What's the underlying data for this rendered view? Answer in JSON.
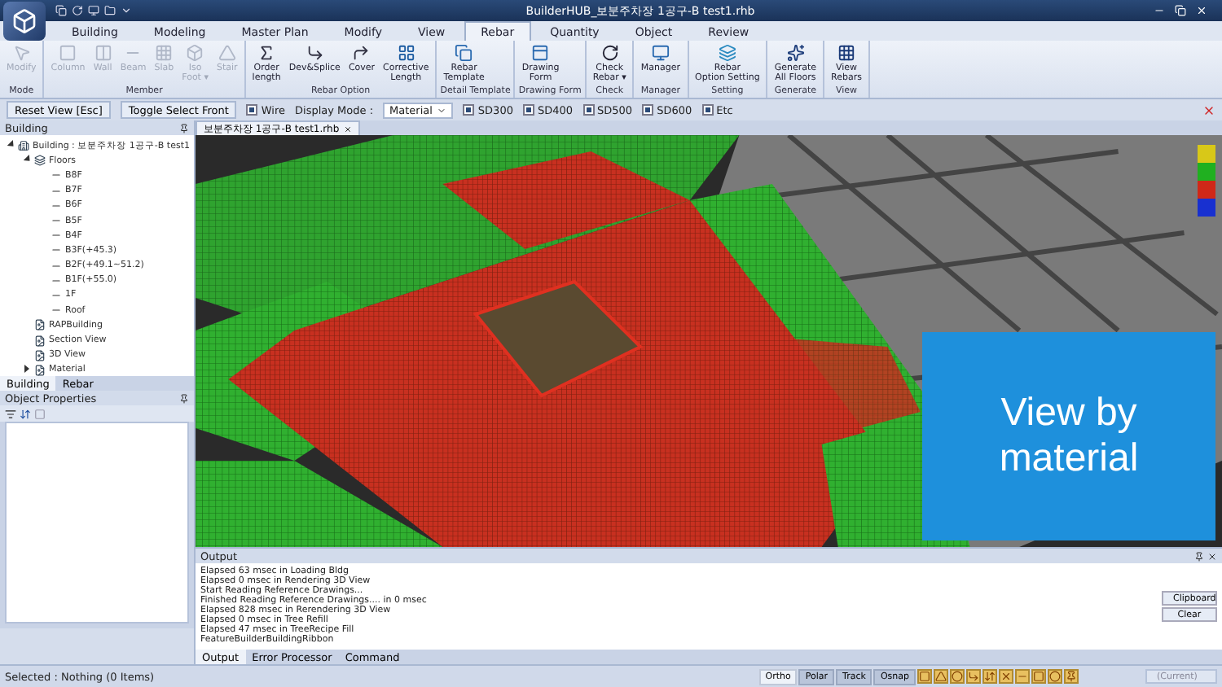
{
  "window": {
    "title": "BuilderHUB_보분주차장 1공구-B test1.rhb"
  },
  "tabs": [
    {
      "label": "Building",
      "selected": false
    },
    {
      "label": "Modeling",
      "selected": false
    },
    {
      "label": "Master Plan",
      "selected": false
    },
    {
      "label": "Modify",
      "selected": false
    },
    {
      "label": "View",
      "selected": false
    },
    {
      "label": "Rebar",
      "selected": true
    },
    {
      "label": "Quantity",
      "selected": false
    },
    {
      "label": "Object",
      "selected": false
    },
    {
      "label": "Review",
      "selected": false
    }
  ],
  "ribbon": [
    {
      "label": "Mode",
      "buttons": [
        {
          "label": "Modify",
          "disabled": true
        }
      ]
    },
    {
      "label": "Member",
      "buttons": [
        {
          "label": "Column",
          "disabled": true
        },
        {
          "label": "Wall",
          "disabled": true
        },
        {
          "label": "Beam",
          "disabled": true
        },
        {
          "label": "Slab",
          "disabled": true
        },
        {
          "label": "Iso\nFoot ▾",
          "disabled": true
        },
        {
          "label": "Stair",
          "disabled": true
        }
      ]
    },
    {
      "label": "Rebar Option",
      "buttons": [
        {
          "label": "Order\nlength",
          "disabled": false
        },
        {
          "label": "Dev&Splice",
          "disabled": false
        },
        {
          "label": "Cover",
          "disabled": false
        },
        {
          "label": "Corrective\nLength",
          "disabled": false
        }
      ]
    },
    {
      "label": "Detail Template",
      "buttons": [
        {
          "label": "Rebar\nTemplate",
          "disabled": false
        }
      ]
    },
    {
      "label": "Drawing Form",
      "buttons": [
        {
          "label": "Drawing\nForm",
          "disabled": false
        }
      ]
    },
    {
      "label": "Check",
      "buttons": [
        {
          "label": "Check\nRebar ▾",
          "disabled": false
        }
      ]
    },
    {
      "label": "Manager",
      "buttons": [
        {
          "label": "Manager",
          "disabled": false
        }
      ]
    },
    {
      "label": "Setting",
      "buttons": [
        {
          "label": "Rebar\nOption Setting",
          "disabled": false
        }
      ]
    },
    {
      "label": "Generate",
      "buttons": [
        {
          "label": "Generate\nAll Floors",
          "disabled": false
        }
      ]
    },
    {
      "label": "View",
      "buttons": [
        {
          "label": "View\nRebars",
          "disabled": false
        }
      ]
    }
  ],
  "option_bar": {
    "reset_button": "Reset View [Esc]",
    "toggle_button": "Toggle Select Front",
    "wire": {
      "label": "Wire",
      "checked": true
    },
    "display_mode_label": "Display Mode :",
    "display_mode": "Material",
    "grades": [
      {
        "label": "SD300",
        "checked": true
      },
      {
        "label": "SD400",
        "checked": true
      },
      {
        "label": "SD500",
        "checked": true
      },
      {
        "label": "SD600",
        "checked": true
      },
      {
        "label": "Etc",
        "checked": true
      }
    ]
  },
  "building_panel": {
    "title": "Building",
    "tree": [
      {
        "label": "Building : 보분주차장 1공구-B test1",
        "expanded": true,
        "children": [
          {
            "label": "Floors",
            "expanded": true,
            "children": [
              {
                "label": "B8F"
              },
              {
                "label": "B7F"
              },
              {
                "label": "B6F"
              },
              {
                "label": "B5F"
              },
              {
                "label": "B4F"
              },
              {
                "label": "B3F(+45.3)"
              },
              {
                "label": "B2F(+49.1~51.2)"
              },
              {
                "label": "B1F(+55.0)"
              },
              {
                "label": "1F"
              },
              {
                "label": "Roof"
              }
            ]
          },
          {
            "label": "RAPBuilding"
          },
          {
            "label": "Section View"
          },
          {
            "label": "3D View"
          },
          {
            "label": "Material",
            "expanded": false
          }
        ]
      }
    ],
    "tabs": [
      {
        "label": "Building",
        "selected": true
      },
      {
        "label": "Rebar",
        "selected": false
      }
    ]
  },
  "properties_panel": {
    "title": "Object Properties"
  },
  "document_tab": "보분주차장 1공구-B test1.rhb",
  "viewport": {
    "overlay": "View by material",
    "legend": [
      {
        "color": "#d8c818"
      },
      {
        "color": "#20b020"
      },
      {
        "color": "#d02818"
      },
      {
        "color": "#1830d0"
      }
    ]
  },
  "output": {
    "title": "Output",
    "lines": [
      "Elapsed 63 msec in Loading Bldg",
      "Elapsed 0 msec in Rendering 3D View",
      "Start Reading Reference Drawings...",
      "Finished Reading Reference Drawings.... in 0 msec",
      "Elapsed 828 msec in Rerendering 3D View",
      "Elapsed 0 msec in Tree Refill",
      "Elapsed 47 msec in TreeRecipe Fill",
      "FeatureBuilderBuildingRibbon"
    ],
    "buttons": [
      "Clipboard",
      "Clear"
    ],
    "tabs": [
      {
        "label": "Output",
        "selected": true
      },
      {
        "label": "Error Processor",
        "selected": false
      },
      {
        "label": "Command",
        "selected": false
      }
    ]
  },
  "status_bar": {
    "selection": "Selected : Nothing (0 Items)",
    "toggles": [
      {
        "label": "Ortho",
        "on": false
      },
      {
        "label": "Polar",
        "on": true
      },
      {
        "label": "Track",
        "on": true
      },
      {
        "label": "Osnap",
        "on": true
      }
    ],
    "layer": "(Current)"
  }
}
